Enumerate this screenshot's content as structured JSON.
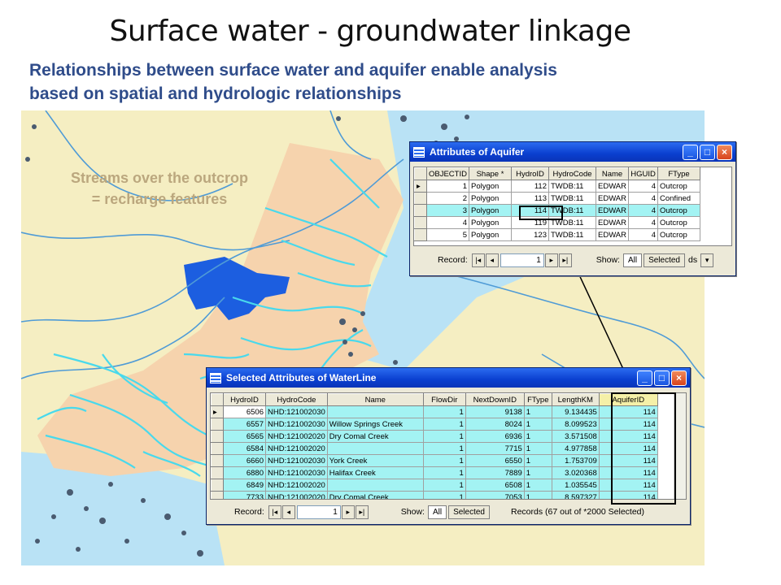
{
  "slide": {
    "title": "Surface water  - groundwater linkage",
    "subtitle_line1": "Relationships between surface water and aquifer enable analysis",
    "subtitle_line2": "based on spatial and hydrologic relationships"
  },
  "map": {
    "note_line1": "Streams over the outcrop",
    "note_line2": "= recharge features",
    "colors": {
      "background": "#f5eec2",
      "outcrop": "#f6d3ad",
      "aquifer": "#b9e2f5",
      "streams": "#49d9ec",
      "rivers": "#4f9bd6",
      "lake": "#1c5ee0",
      "wells": "#4a5b70"
    }
  },
  "aquifer_window": {
    "title": "Attributes of Aquifer",
    "columns": [
      "OBJECTID",
      "Shape *",
      "HydroID",
      "HydroCode",
      "Name",
      "HGUID",
      "FType"
    ],
    "rows": [
      [
        "1",
        "Polygon",
        "112",
        "TWDB:11",
        "EDWAR",
        "4",
        "Outcrop"
      ],
      [
        "2",
        "Polygon",
        "113",
        "TWDB:11",
        "EDWAR",
        "4",
        "Confined"
      ],
      [
        "3",
        "Polygon",
        "114",
        "TWDB:11",
        "EDWAR",
        "4",
        "Outcrop"
      ],
      [
        "4",
        "Polygon",
        "119",
        "TWDB:11",
        "EDWAR",
        "4",
        "Outcrop"
      ],
      [
        "5",
        "Polygon",
        "123",
        "TWDB:11",
        "EDWAR",
        "4",
        "Outcrop"
      ]
    ],
    "highlighted_row": 2,
    "record_label": "Record:",
    "record_value": "1",
    "show_label": "Show:",
    "show_all": "All",
    "show_selected": "Selected",
    "records_text": "ds"
  },
  "waterline_window": {
    "title": "Selected Attributes of WaterLine",
    "columns": [
      "HydroID",
      "HydroCode",
      "Name",
      "FlowDir",
      "NextDownID",
      "FType",
      "LengthKM",
      "AquiferID"
    ],
    "rows": [
      [
        "6506",
        "NHD:121002030",
        "",
        "1",
        "9138",
        "1",
        "9.134435",
        "114"
      ],
      [
        "6557",
        "NHD:121002030",
        "Willow Springs Creek",
        "1",
        "8024",
        "1",
        "8.099523",
        "114"
      ],
      [
        "6565",
        "NHD:121002020",
        "Dry Comal Creek",
        "1",
        "6936",
        "1",
        "3.571508",
        "114"
      ],
      [
        "6584",
        "NHD:121002020",
        "",
        "1",
        "7715",
        "1",
        "4.977858",
        "114"
      ],
      [
        "6660",
        "NHD:121002030",
        "York Creek",
        "1",
        "6550",
        "1",
        "1.753709",
        "114"
      ],
      [
        "6880",
        "NHD:121002030",
        "Halifax Creek",
        "1",
        "7889",
        "1",
        "3.020368",
        "114"
      ],
      [
        "6849",
        "NHD:121002020",
        "",
        "1",
        "6508",
        "1",
        "1.035545",
        "114"
      ],
      [
        "7733",
        "NHD:121002020",
        "Dry Comal Creek",
        "1",
        "7053",
        "1",
        "8.597327",
        "114"
      ]
    ],
    "record_label": "Record:",
    "record_value": "1",
    "show_label": "Show:",
    "show_all": "All",
    "show_selected": "Selected",
    "records_text": "Records (67 out of *2000 Selected)"
  }
}
